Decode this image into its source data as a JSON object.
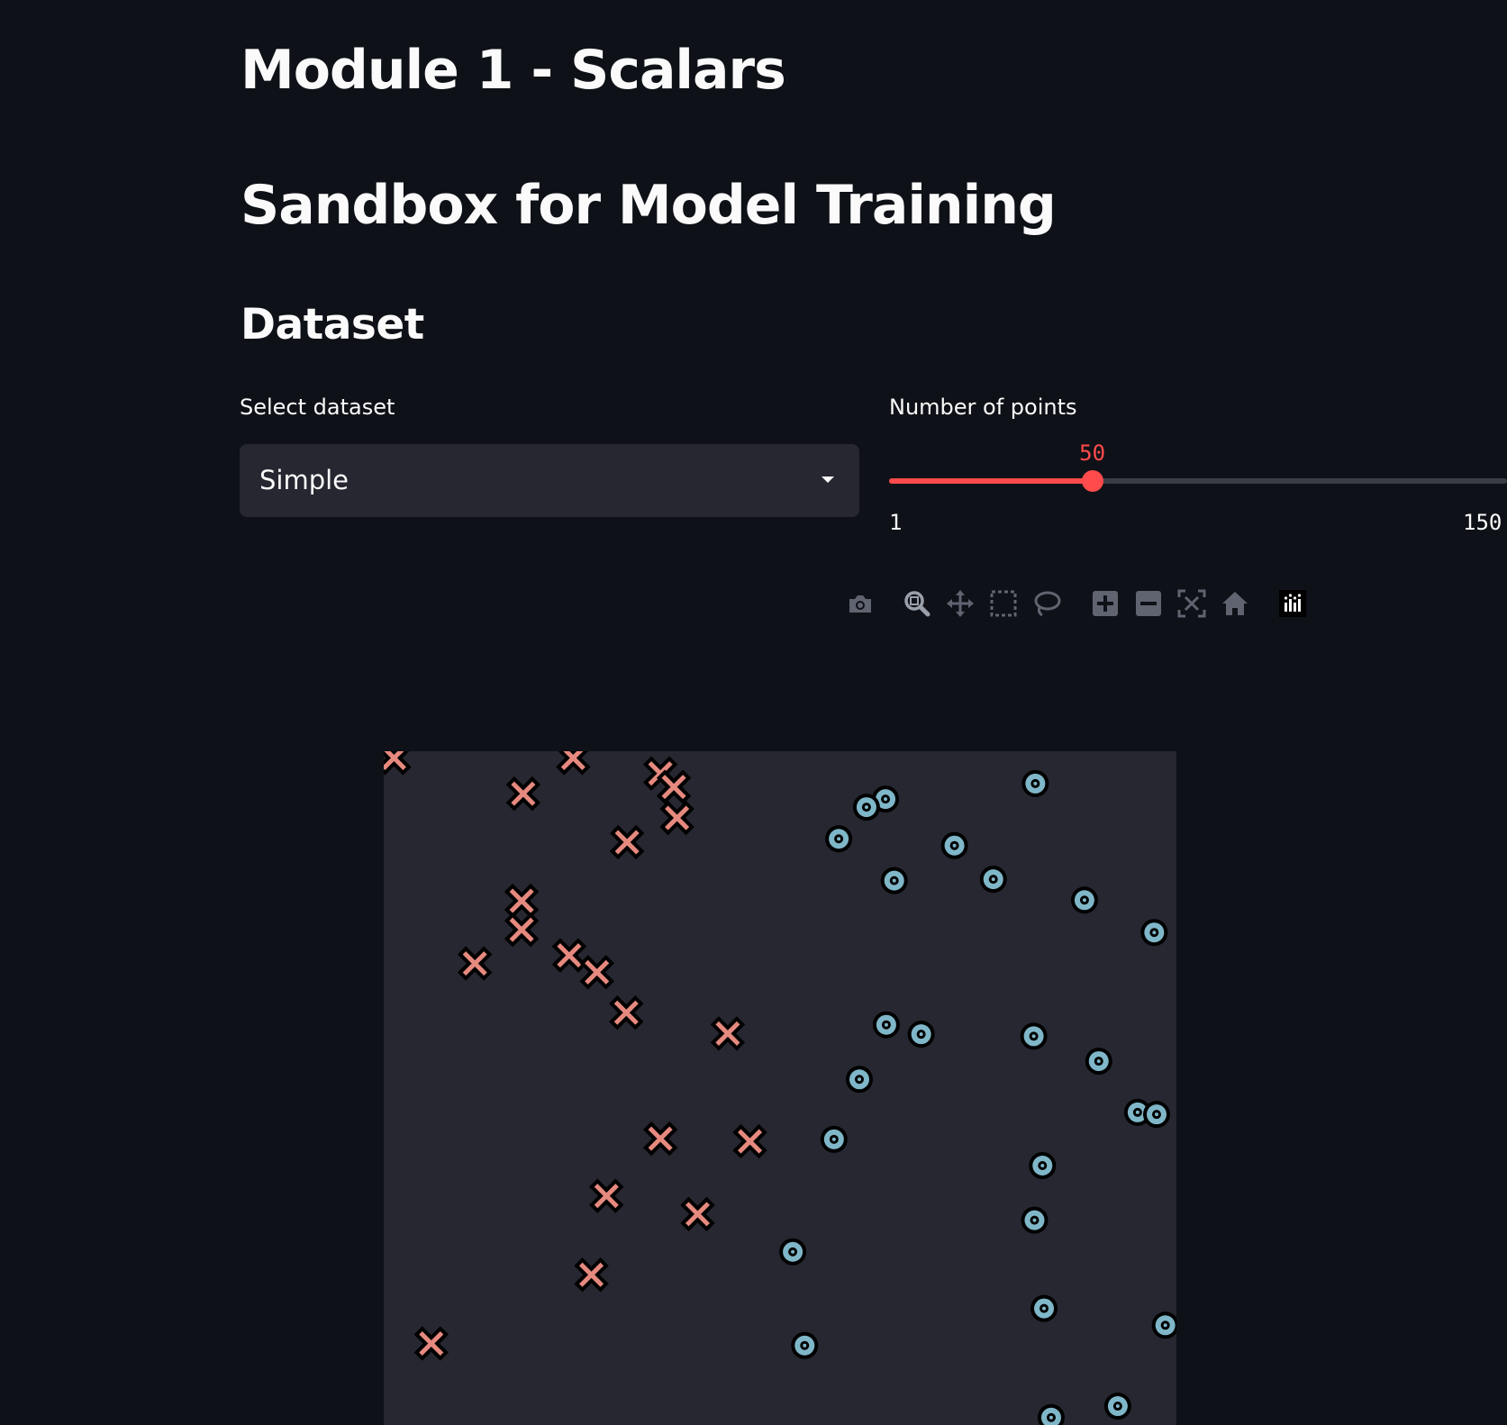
{
  "headings": {
    "title": "Module 1 - Scalars",
    "subtitle": "Sandbox for Model Training",
    "section": "Dataset"
  },
  "dataset_select": {
    "label": "Select dataset",
    "value": "Simple"
  },
  "points_slider": {
    "label": "Number of points",
    "value": 50,
    "value_text": "50",
    "min": 1,
    "min_text": "1",
    "max": 150,
    "max_text": "150",
    "accent_color": "#ff4b4b"
  },
  "modebar": {
    "icons": [
      "camera-icon",
      "zoom-icon",
      "pan-icon",
      "box-select-icon",
      "lasso-select-icon",
      "zoom-in-icon",
      "zoom-out-icon",
      "autoscale-icon",
      "reset-axes-icon",
      "plotly-logo-icon"
    ]
  },
  "chart_data": {
    "type": "scatter",
    "title": "",
    "xlabel": "",
    "ylabel": "",
    "xlim": [
      0,
      1
    ],
    "ylim": [
      0,
      1
    ],
    "grid": false,
    "background": "#262730",
    "series": [
      {
        "marker": "x",
        "color": "#e6897f",
        "points": [
          {
            "x": 0.013,
            "y": 0.99
          },
          {
            "x": 0.239,
            "y": 0.99
          },
          {
            "x": 0.176,
            "y": 0.937
          },
          {
            "x": 0.349,
            "y": 0.967
          },
          {
            "x": 0.366,
            "y": 0.947
          },
          {
            "x": 0.37,
            "y": 0.901
          },
          {
            "x": 0.307,
            "y": 0.865
          },
          {
            "x": 0.174,
            "y": 0.778
          },
          {
            "x": 0.174,
            "y": 0.735
          },
          {
            "x": 0.115,
            "y": 0.685
          },
          {
            "x": 0.234,
            "y": 0.697
          },
          {
            "x": 0.269,
            "y": 0.672
          },
          {
            "x": 0.306,
            "y": 0.612
          },
          {
            "x": 0.434,
            "y": 0.581
          },
          {
            "x": 0.349,
            "y": 0.425
          },
          {
            "x": 0.462,
            "y": 0.421
          },
          {
            "x": 0.281,
            "y": 0.34
          },
          {
            "x": 0.396,
            "y": 0.313
          },
          {
            "x": 0.262,
            "y": 0.223
          },
          {
            "x": 0.06,
            "y": 0.121
          }
        ]
      },
      {
        "marker": "circle",
        "color": "#7fb7c9",
        "points": [
          {
            "x": 0.822,
            "y": 0.952
          },
          {
            "x": 0.633,
            "y": 0.929
          },
          {
            "x": 0.609,
            "y": 0.917
          },
          {
            "x": 0.574,
            "y": 0.87
          },
          {
            "x": 0.72,
            "y": 0.86
          },
          {
            "x": 0.644,
            "y": 0.808
          },
          {
            "x": 0.769,
            "y": 0.81
          },
          {
            "x": 0.884,
            "y": 0.779
          },
          {
            "x": 0.972,
            "y": 0.731
          },
          {
            "x": 0.634,
            "y": 0.594
          },
          {
            "x": 0.678,
            "y": 0.58
          },
          {
            "x": 0.82,
            "y": 0.577
          },
          {
            "x": 0.902,
            "y": 0.54
          },
          {
            "x": 0.6,
            "y": 0.513
          },
          {
            "x": 0.951,
            "y": 0.464
          },
          {
            "x": 0.975,
            "y": 0.461
          },
          {
            "x": 0.568,
            "y": 0.424
          },
          {
            "x": 0.831,
            "y": 0.385
          },
          {
            "x": 0.821,
            "y": 0.304
          },
          {
            "x": 0.516,
            "y": 0.257
          },
          {
            "x": 0.833,
            "y": 0.173
          },
          {
            "x": 0.986,
            "y": 0.148
          },
          {
            "x": 0.531,
            "y": 0.118
          },
          {
            "x": 0.926,
            "y": 0.028
          },
          {
            "x": 0.842,
            "y": 0.011
          }
        ]
      }
    ]
  }
}
